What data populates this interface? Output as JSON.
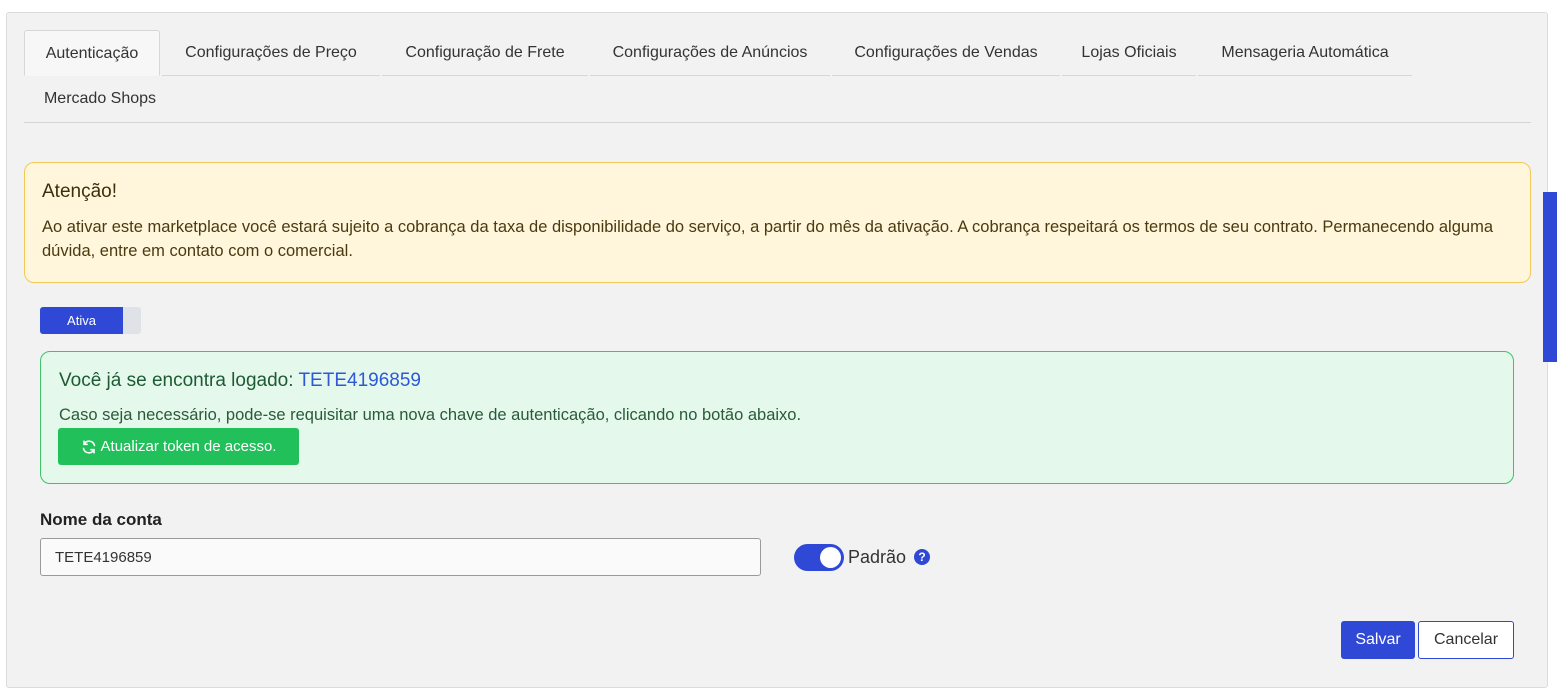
{
  "tabs": [
    {
      "label": "Autenticação"
    },
    {
      "label": "Configurações de Preço"
    },
    {
      "label": "Configuração de Frete"
    },
    {
      "label": "Configurações de Anúncios"
    },
    {
      "label": "Configurações de Vendas"
    },
    {
      "label": "Lojas Oficiais"
    },
    {
      "label": "Mensageria Automática"
    },
    {
      "label": "Mercado Shops"
    }
  ],
  "warning": {
    "title": "Atenção!",
    "message": "Ao ativar este marketplace você estará sujeito a cobrança da taxa de disponibilidade do serviço, a partir do mês da ativação. A cobrança respeitará os termos de seu contrato. Permanecendo alguma dúvida, entre em contato com o comercial."
  },
  "status": {
    "label": "Ativa"
  },
  "login": {
    "title_prefix": "Você já se encontra logado:",
    "account": "TETE4196859",
    "message": "Caso seja necessário, pode-se requisitar uma nova chave de autenticação, clicando no botão abaixo.",
    "button_label": "Atualizar token de acesso.",
    "button_icon": "refresh-icon"
  },
  "account_field": {
    "label": "Nome da conta",
    "value": "TETE4196859"
  },
  "default_switch": {
    "label": "Padrão",
    "help_glyph": "?"
  },
  "actions": {
    "save_label": "Salvar",
    "cancel_label": "Cancelar"
  },
  "colors": {
    "primary": "#2f48d6",
    "success": "#22c05a",
    "warning_border": "#f1c85a"
  }
}
